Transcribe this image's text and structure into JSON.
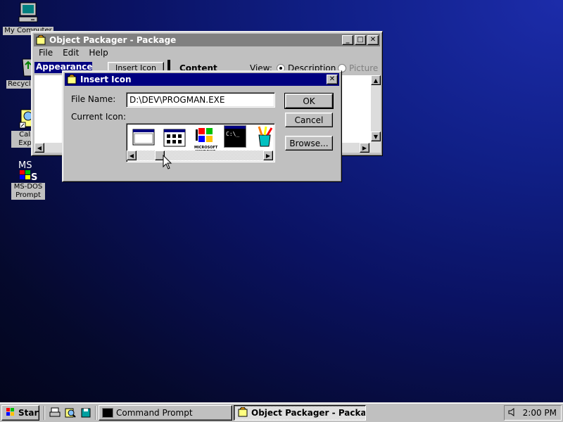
{
  "desktop": {
    "icons": [
      {
        "label": "My Computer",
        "icon": "my-computer-icon"
      },
      {
        "label": "Recycle Bin",
        "icon": "recycle-bin-icon"
      },
      {
        "label_line1": "Calm",
        "label_line2": "Explo",
        "icon": "calm-explorer-icon"
      },
      {
        "label_line1": "MS-DOS",
        "label_line2": "Prompt",
        "icon": "ms-dos-prompt-icon"
      }
    ]
  },
  "packager": {
    "title": "Object Packager - Package",
    "menu": [
      "File",
      "Edit",
      "Help"
    ],
    "appearance_label": "Appearance",
    "insert_icon_button": "Insert Icon",
    "content_label": "Content",
    "view_label": "View:",
    "view_options": [
      "Description",
      "Picture"
    ],
    "view_selected": "Description"
  },
  "dialog": {
    "title": "Insert Icon",
    "file_name_label": "File Name:",
    "file_name_value": "D:\\DEV\\PROGMAN.EXE",
    "current_icon_label": "Current Icon:",
    "ok_label": "OK",
    "cancel_label": "Cancel",
    "browse_label": "Browse...",
    "icons": [
      "window-icon",
      "program-group-icon",
      "microsoft-windows-logo-icon",
      "command-prompt-icon",
      "tools-cup-icon"
    ],
    "windows_logo_text": "MICROSOFT WINDOWS",
    "cmd_text": "C:\\_"
  },
  "taskbar": {
    "start_label": "Start",
    "quick_launch": [
      "printer-icon",
      "search-icon",
      "disk-icon"
    ],
    "tasks": [
      {
        "label": "Command Prompt",
        "active": false
      },
      {
        "label": "Object Packager - Package",
        "active": true
      }
    ],
    "clock": "2:00 PM"
  }
}
